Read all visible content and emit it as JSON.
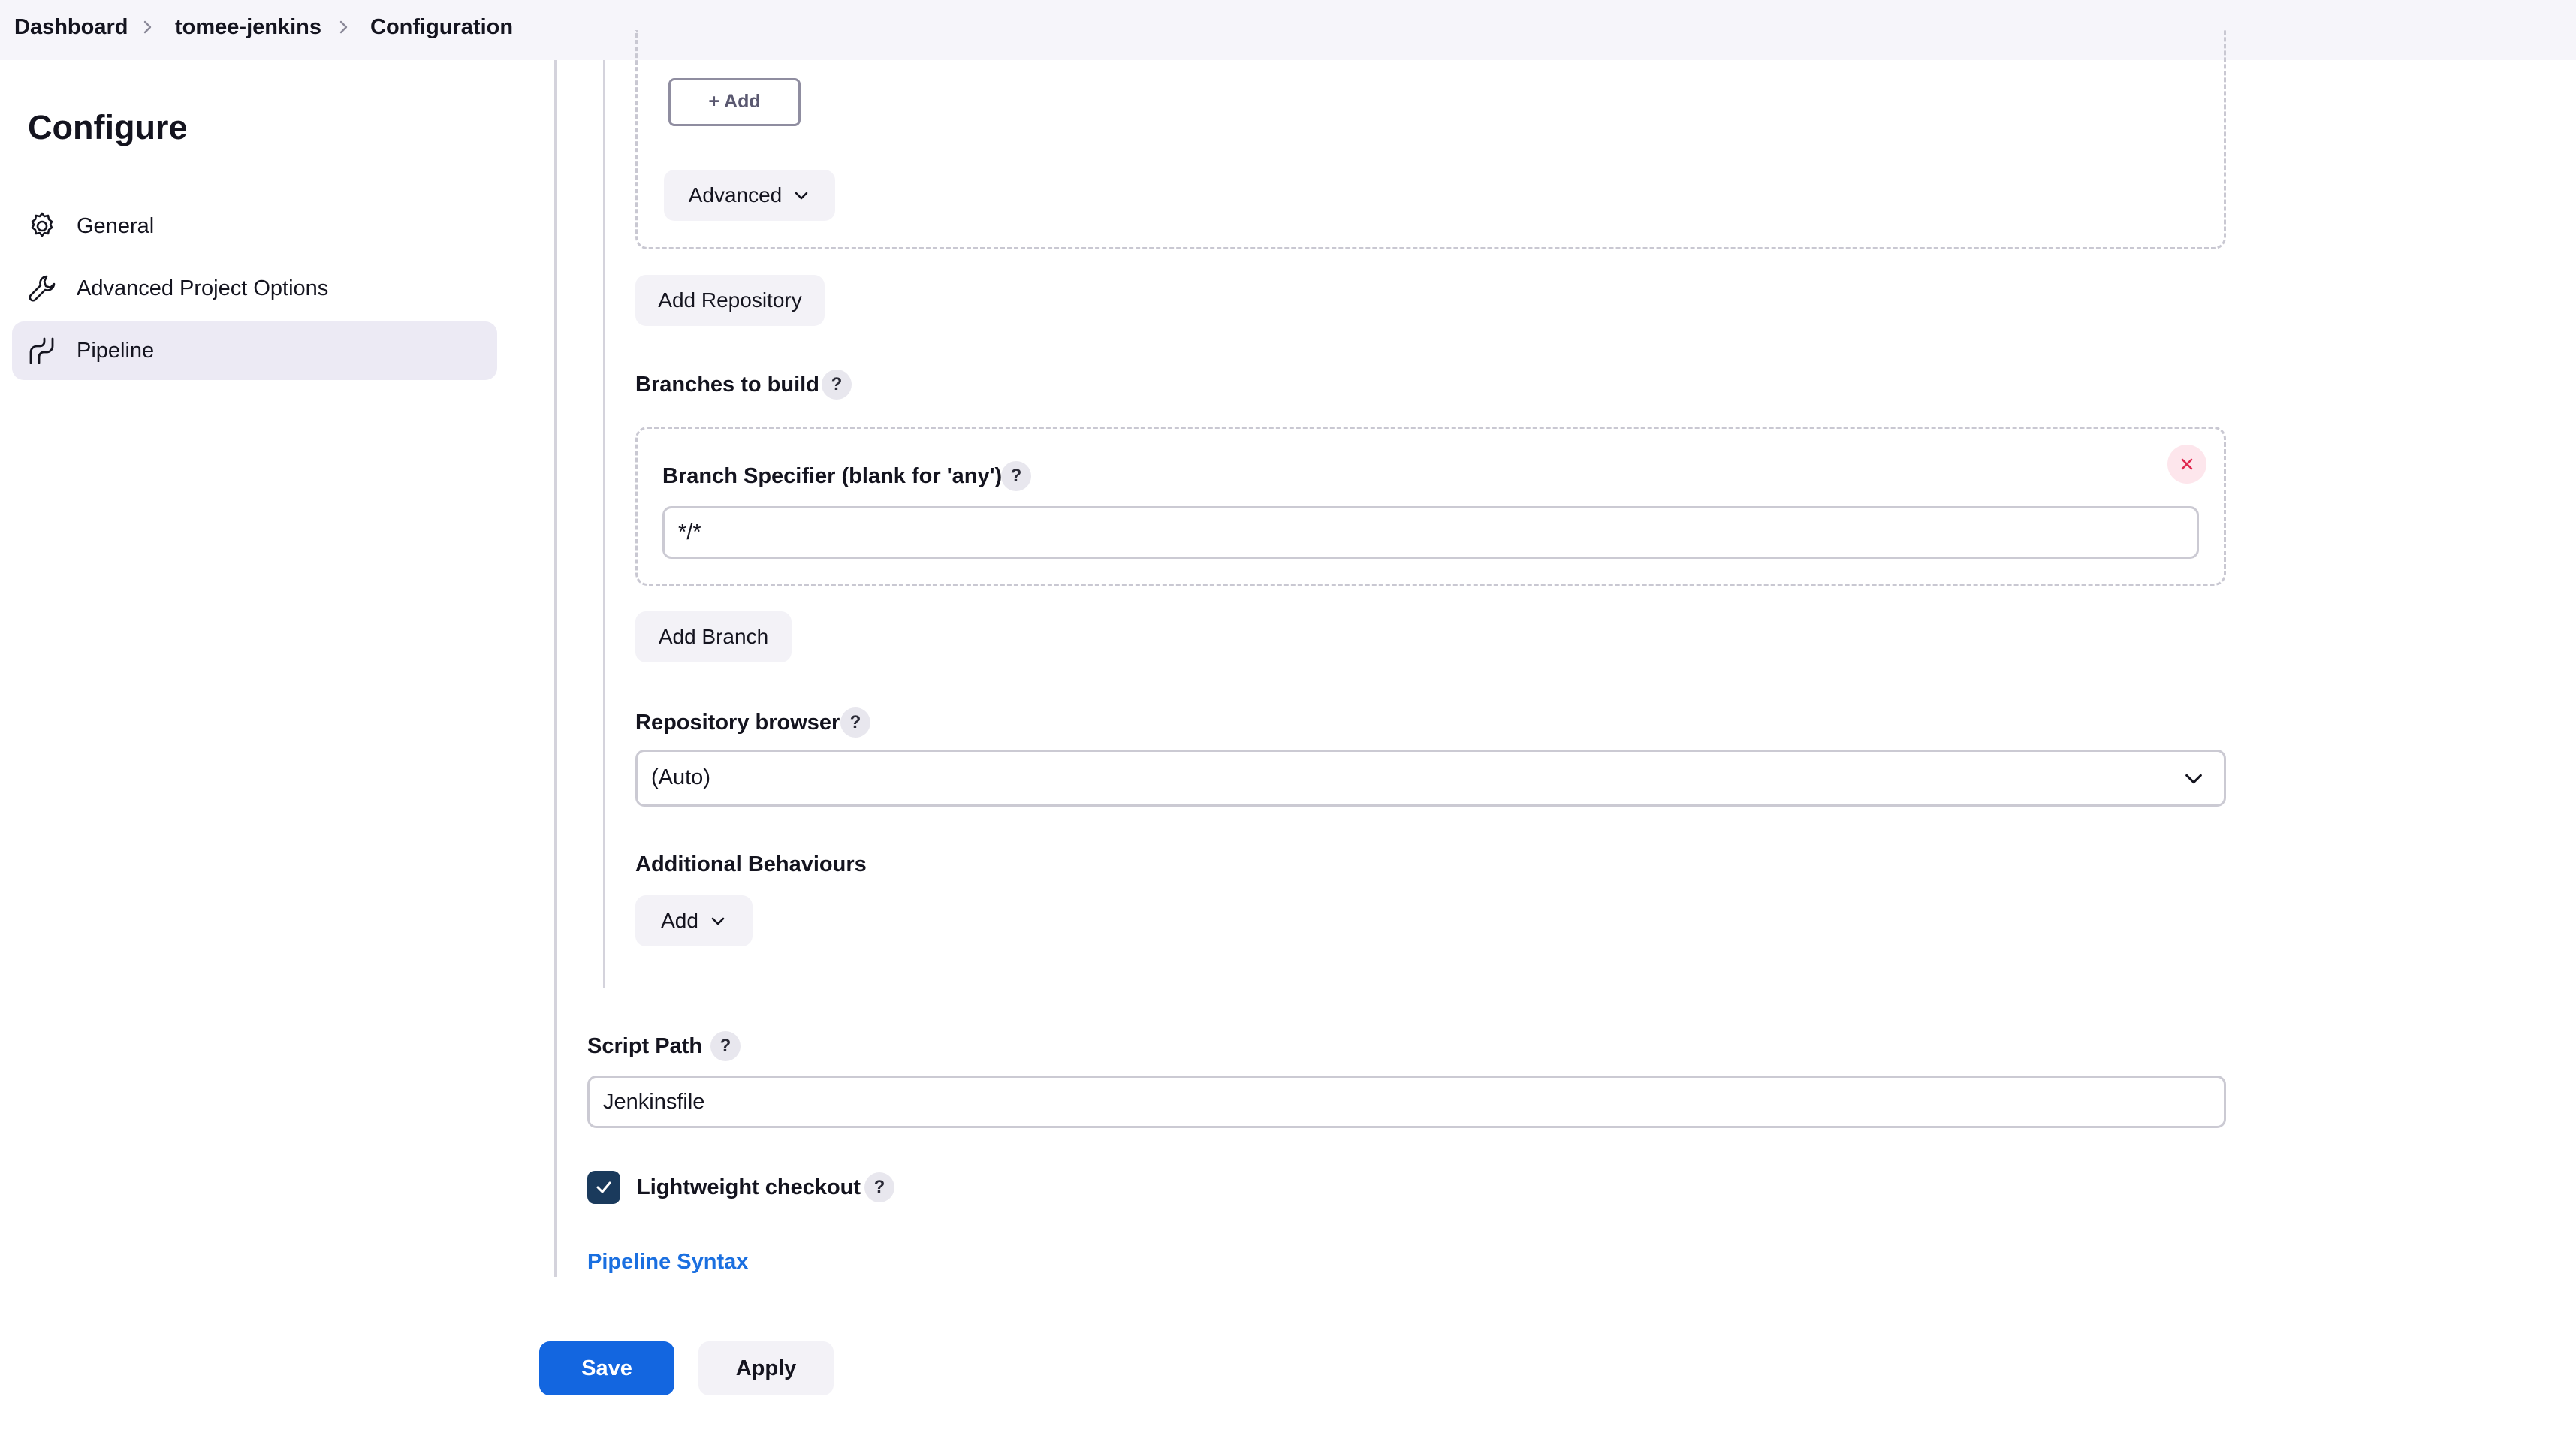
{
  "breadcrumb": {
    "items": [
      "Dashboard",
      "tomee-jenkins",
      "Configuration"
    ]
  },
  "sidebar": {
    "title": "Configure",
    "items": [
      {
        "label": "General",
        "icon": "gear-icon"
      },
      {
        "label": "Advanced Project Options",
        "icon": "wrench-icon"
      },
      {
        "label": "Pipeline",
        "icon": "pipeline-icon",
        "active": true
      }
    ]
  },
  "scm": {
    "add_credential_label": "+ Add",
    "advanced_label": "Advanced",
    "add_repository_label": "Add Repository",
    "branches_label": "Branches to build",
    "branch_specifier_label": "Branch Specifier (blank for 'any')",
    "branch_specifier_value": "*/*",
    "add_branch_label": "Add Branch",
    "repo_browser_label": "Repository browser",
    "repo_browser_value": "(Auto)",
    "additional_behaviours_label": "Additional Behaviours",
    "add_behaviour_label": "Add"
  },
  "pipeline": {
    "script_path_label": "Script Path",
    "script_path_value": "Jenkinsfile",
    "lightweight_label": "Lightweight checkout",
    "lightweight_checked": true,
    "syntax_link": "Pipeline Syntax"
  },
  "help_glyph": "?",
  "footer": {
    "save_label": "Save",
    "apply_label": "Apply"
  },
  "colors": {
    "primary": "#1366e0",
    "link": "#1a6fe0",
    "checkbox": "#1a3a5c",
    "danger": "#e0284f"
  }
}
